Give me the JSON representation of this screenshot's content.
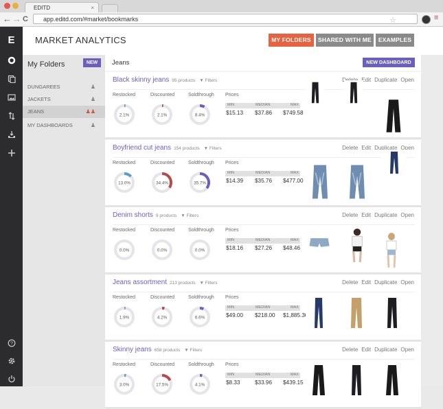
{
  "browser": {
    "tab_title": "EDITD",
    "tab_close": "×",
    "url": "app.editd.com/#market/bookmarks",
    "nav_back": "←",
    "nav_forward": "→",
    "nav_reload": "C",
    "star": "☆",
    "menu": "≡"
  },
  "rail": {
    "logo": "E",
    "icons": [
      "circle",
      "copy",
      "image",
      "sort",
      "inbox",
      "plus",
      "help",
      "gear",
      "power"
    ]
  },
  "header": {
    "title": "MARKET ANALYTICS",
    "buttons": [
      {
        "label": "MY FOLDERS",
        "color": "#e8623f"
      },
      {
        "label": "SHARED WITH ME",
        "color": "#8a8a8a"
      },
      {
        "label": "EXAMPLES",
        "color": "#8a8a8a"
      }
    ]
  },
  "folders": {
    "title": "My Folders",
    "new_label": "NEW",
    "items": [
      {
        "label": "DUNGAREES",
        "icon": "user-icon"
      },
      {
        "label": "JACKETS",
        "icon": "user-icon"
      },
      {
        "label": "JEANS",
        "icon": "users-icon",
        "active": true
      },
      {
        "label": "MY DASHBOARDS",
        "icon": "user-icon"
      }
    ]
  },
  "main": {
    "title": "Jeans",
    "new_dashboard": "NEW DASHBOARD"
  },
  "card_labels": {
    "restocked": "Restocked",
    "discounted": "Discounted",
    "soldthrough": "Soldthrough",
    "prices": "Prices",
    "min": "MIN",
    "median": "MEDIAN",
    "max": "MAX",
    "filters": "▼ Filters",
    "actions": [
      "Delete",
      "Edit",
      "Duplicate",
      "Open"
    ]
  },
  "colors": {
    "restocked": "#5b9ec7",
    "discounted": "#b84a4a",
    "soldthrough": "#6a5fc0",
    "accent": "#6a5fc0"
  },
  "cards": [
    {
      "name": "Black skinny jeans",
      "products": "95 products",
      "restocked": 2.1,
      "discounted": 2.1,
      "soldthrough": 8.4,
      "restocked_label": "2.1%",
      "discounted_label": "2.1%",
      "soldthrough_label": "8.4%",
      "min": "$15.13",
      "median": "$37.86",
      "max": "$749.58"
    },
    {
      "name": "Boyfriend cut jeans",
      "products": "154 products",
      "restocked": 13.0,
      "discounted": 34.4,
      "soldthrough": 35.7,
      "restocked_label": "13.0%",
      "discounted_label": "34.4%",
      "soldthrough_label": "35.7%",
      "min": "$14.39",
      "median": "$35.76",
      "max": "$477.00"
    },
    {
      "name": "Denim shorts",
      "products": "9 products",
      "restocked": 0,
      "discounted": 0,
      "soldthrough": 0,
      "restocked_label": "0.0%",
      "discounted_label": "0.0%",
      "soldthrough_label": "0.0%",
      "min": "$18.16",
      "median": "$27.26",
      "max": "$48.46"
    },
    {
      "name": "Jeans assortment",
      "products": "213 products",
      "restocked": 1.9,
      "discounted": 4.2,
      "soldthrough": 6.6,
      "restocked_label": "1.9%",
      "discounted_label": "4.2%",
      "soldthrough_label": "6.6%",
      "min": "$49.00",
      "median": "$218.00",
      "max": "$1,885.30"
    },
    {
      "name": "Skinny jeans",
      "products": "658 products",
      "restocked": 3.0,
      "discounted": 17.5,
      "soldthrough": 4.1,
      "restocked_label": "3.0%",
      "discounted_label": "17.5%",
      "soldthrough_label": "4.1%",
      "min": "$8.33",
      "median": "$33.96",
      "max": "$439.15"
    }
  ]
}
